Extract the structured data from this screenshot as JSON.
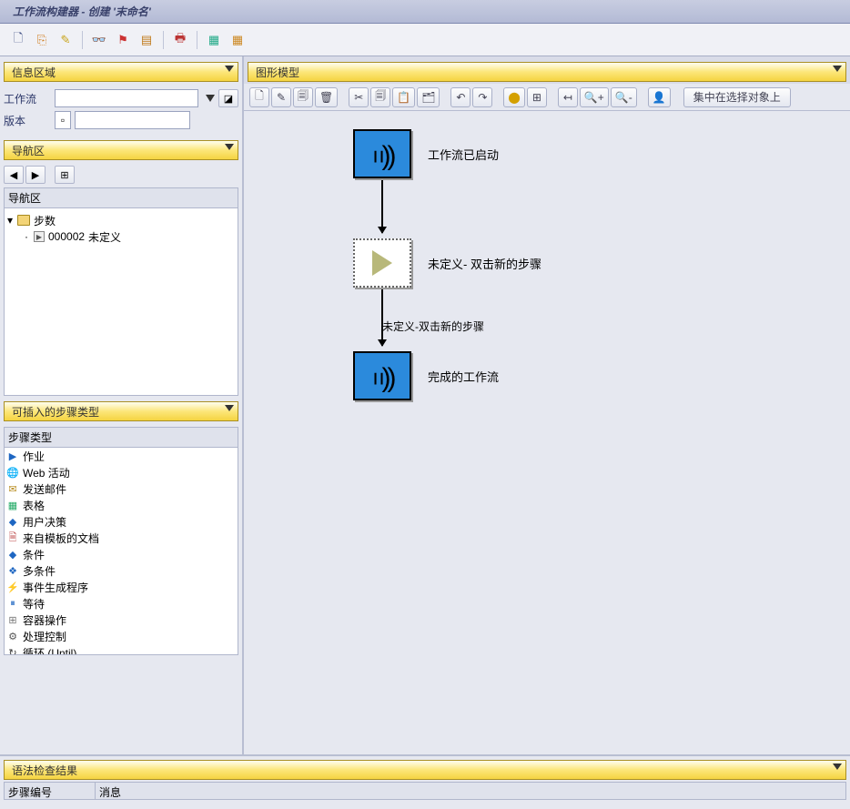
{
  "titlebar": "工作流构建器 - 创建 '末命名'",
  "main_toolbar": {
    "new": "new-icon",
    "copy": "copy-icon",
    "wand": "wand-icon",
    "lens": "lens-icon",
    "flag": "flag-icon",
    "props": "props-icon",
    "print": "print-icon",
    "grid": "grid-icon",
    "grid2": "grid2-icon"
  },
  "info_panel": {
    "header": "信息区域",
    "workflow_label": "工作流",
    "workflow_value": "",
    "version_label": "版本",
    "version_value": ""
  },
  "nav_panel": {
    "header": "导航区",
    "tree_header": "导航区",
    "root": "步数",
    "leaf_id": "000002",
    "leaf_text": "未定义"
  },
  "step_types": {
    "header": "可插入的步骤类型",
    "col_header": "步骤类型",
    "items": [
      {
        "icon": "▶",
        "color": "#1e66c2",
        "label": "作业"
      },
      {
        "icon": "🌐",
        "color": "#1e66c2",
        "label": "Web 活动"
      },
      {
        "icon": "✉",
        "color": "#b88c1f",
        "label": "发送邮件"
      },
      {
        "icon": "▦",
        "color": "#2a6",
        "label": "表格"
      },
      {
        "icon": "◆",
        "color": "#1e66c2",
        "label": "用户决策"
      },
      {
        "icon": "🗎",
        "color": "#b44",
        "label": "来自模板的文档"
      },
      {
        "icon": "◆",
        "color": "#1e66c2",
        "label": "条件"
      },
      {
        "icon": "❖",
        "color": "#1e66c2",
        "label": "多条件"
      },
      {
        "icon": "⚡",
        "color": "#c82",
        "label": "事件生成程序"
      },
      {
        "icon": "⏸",
        "color": "#1e66c2",
        "label": "等待"
      },
      {
        "icon": "⊞",
        "color": "#777",
        "label": "容器操作"
      },
      {
        "icon": "⚙",
        "color": "#555",
        "label": "处理控制"
      },
      {
        "icon": "↻",
        "color": "#333",
        "label": "循环 (Until)"
      }
    ]
  },
  "graph": {
    "header": "图形模型",
    "focus_btn": "集中在选择对象上",
    "start_label": "工作流已启动",
    "undef_label": "未定义- 双击新的步骤",
    "edge_label": "未定义-双击新的步骤",
    "end_label": "完成的工作流"
  },
  "syntax": {
    "header": "语法检查结果",
    "col1": "步骤编号",
    "col2": "消息"
  }
}
